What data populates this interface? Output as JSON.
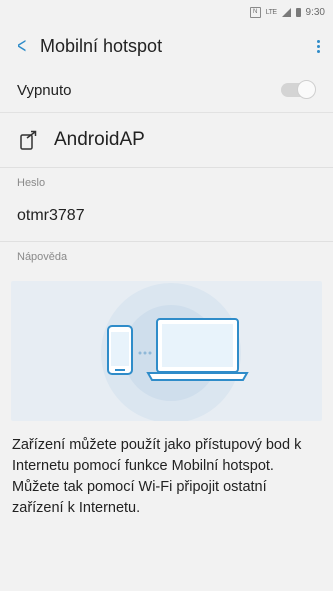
{
  "status_bar": {
    "nfc": "N",
    "network": "LTE",
    "time": "9:30",
    "icons": [
      "nfc-icon",
      "lte-icon",
      "signal-icon",
      "battery-icon"
    ]
  },
  "header": {
    "title": "Mobilní hotspot",
    "back_icon": "chevron-left-icon",
    "more_icon": "more-vert-icon",
    "accent_color": "#2f8cc9"
  },
  "hotspot_toggle": {
    "label": "Vypnuto",
    "state": "off"
  },
  "network": {
    "icon": "share-device-icon",
    "name": "AndroidAP"
  },
  "password": {
    "section_label": "Heslo",
    "value": "otmr3787"
  },
  "help": {
    "section_label": "Nápověda",
    "illustration": "phone-connected-laptop-illustration",
    "text": "Zařízení můžete použít jako přístupový bod k Internetu pomocí funkce Mobilní hotspot. Můžete tak pomocí Wi-Fi připojit ostatní zařízení k Internetu."
  }
}
